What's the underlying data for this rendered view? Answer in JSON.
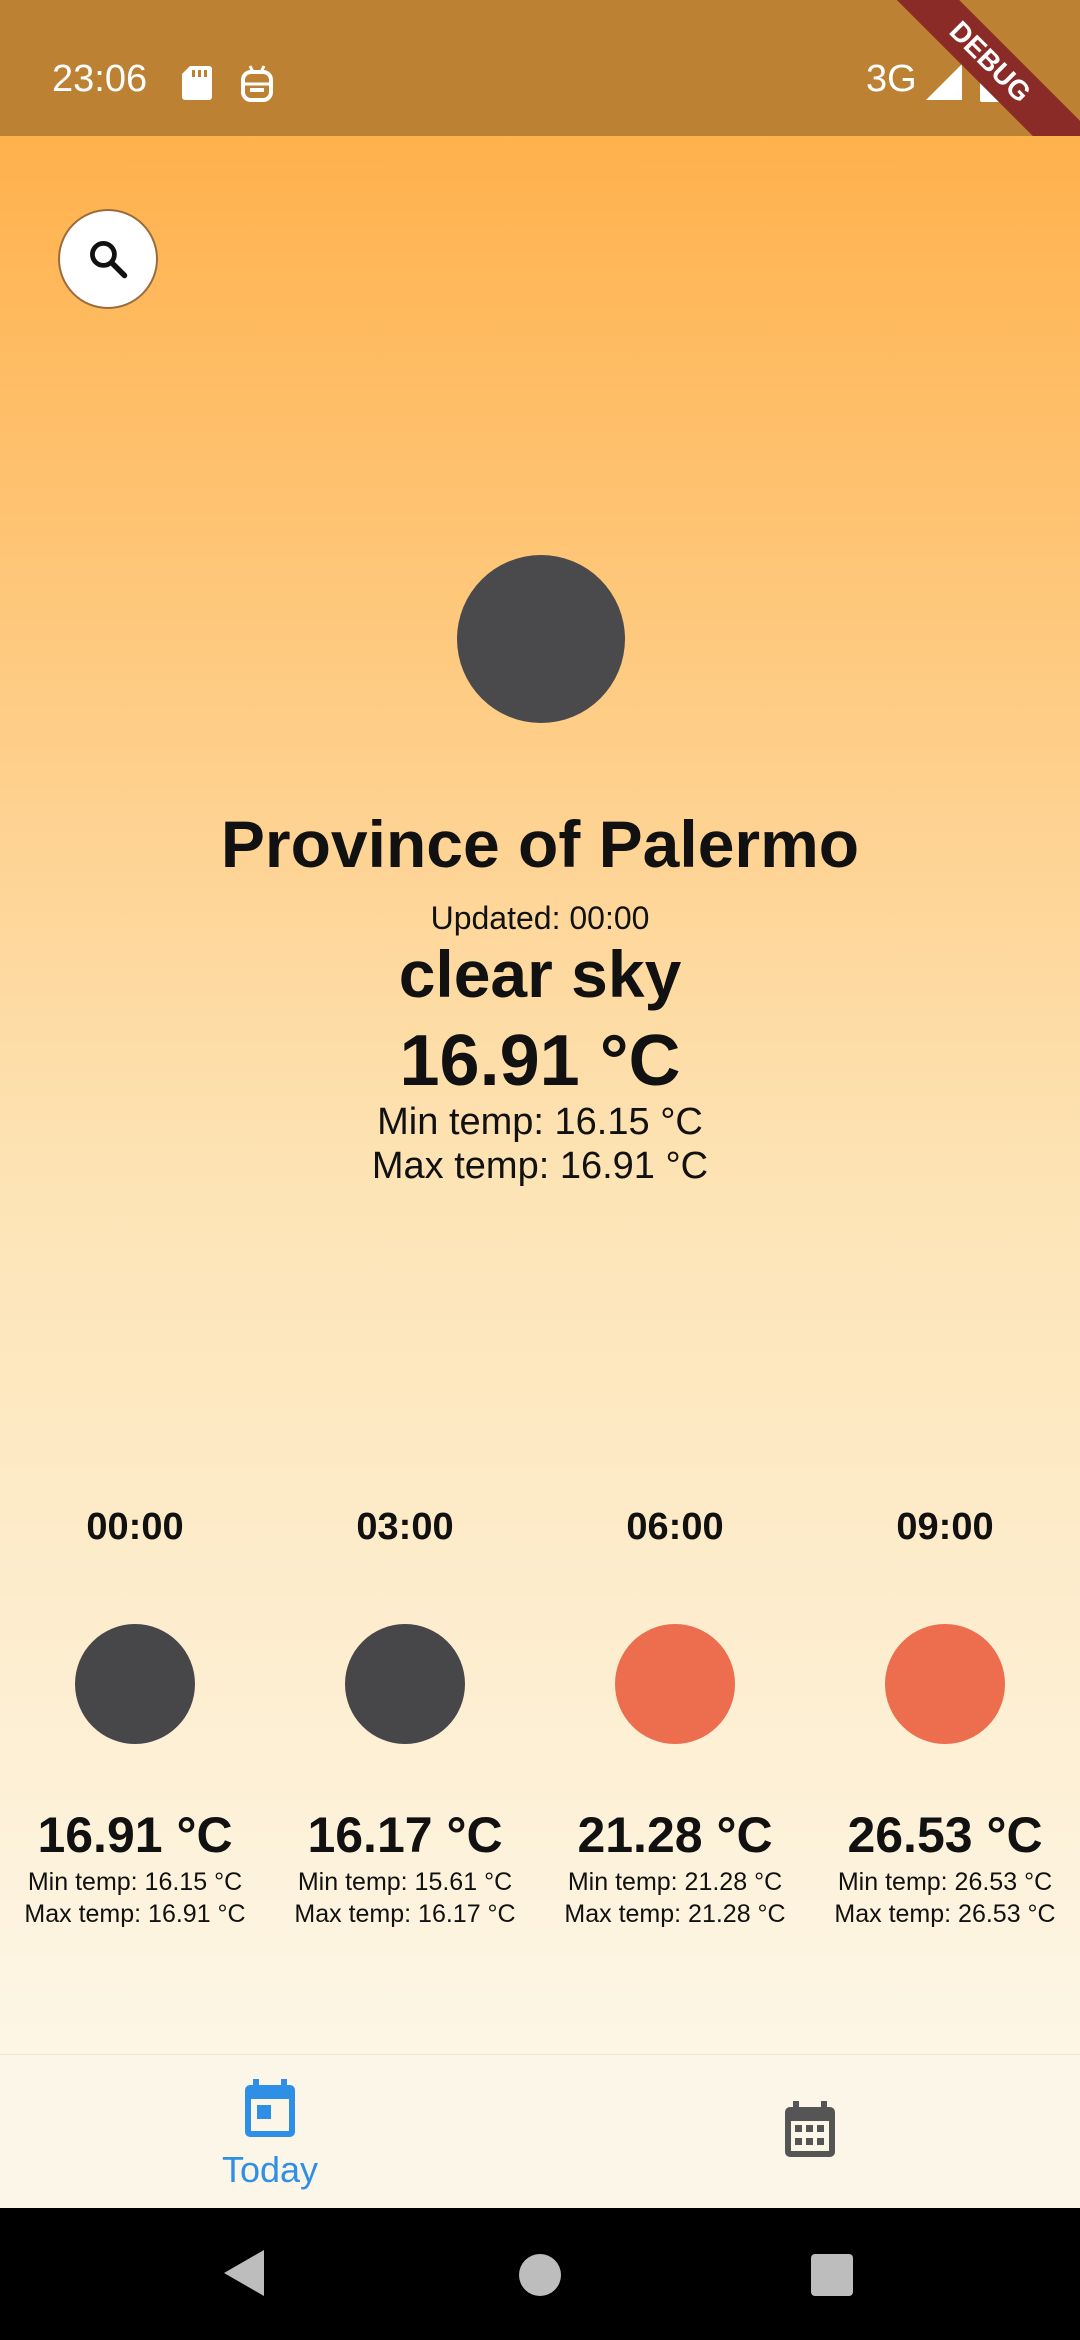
{
  "status_bar": {
    "time": "23:06",
    "network": "3G",
    "debug_label": "DEBUG"
  },
  "current": {
    "city": "Province of Palermo",
    "updated": "Updated: 00:00",
    "condition": "clear sky",
    "temp": "16.91 °C",
    "min_temp": "Min temp: 16.15 °C",
    "max_temp": "Max temp: 16.91 °C",
    "icon_color": "#4a4a4c"
  },
  "forecast": [
    {
      "time": "00:00",
      "temp": "16.91 °C",
      "min": "Min temp: 16.15 °C",
      "max": "Max temp: 16.91 °C",
      "icon_color": "#47474a"
    },
    {
      "time": "03:00",
      "temp": "16.17 °C",
      "min": "Min temp: 15.61 °C",
      "max": "Max temp: 16.17 °C",
      "icon_color": "#47474a"
    },
    {
      "time": "06:00",
      "temp": "21.28 °C",
      "min": "Min temp: 21.28 °C",
      "max": "Max temp: 21.28 °C",
      "icon_color": "#ec6e4e"
    },
    {
      "time": "09:00",
      "temp": "26.53 °C",
      "min": "Min temp: 26.53 °C",
      "max": "Max temp: 26.53 °C",
      "icon_color": "#ec6e4e"
    }
  ],
  "bottom_nav": {
    "today_label": "Today",
    "active_color": "#2f8fe6",
    "inactive_color": "#555555"
  },
  "icons": {
    "search": "search-icon",
    "today": "calendar-today-icon",
    "week": "calendar-month-icon"
  }
}
